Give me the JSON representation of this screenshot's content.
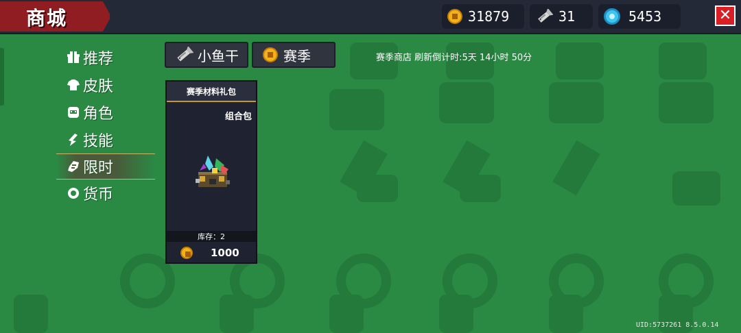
{
  "header": {
    "title": "商城",
    "coins": "31879",
    "fish": "31",
    "gems": "5453",
    "close_label": "✕"
  },
  "nav": {
    "items": [
      {
        "label": "推荐",
        "icon": "gift-icon"
      },
      {
        "label": "皮肤",
        "icon": "shirt-icon"
      },
      {
        "label": "角色",
        "icon": "character-icon"
      },
      {
        "label": "技能",
        "icon": "skill-icon"
      },
      {
        "label": "限时",
        "icon": "limited-time-icon",
        "active": true
      },
      {
        "label": "货币",
        "icon": "currency-icon"
      }
    ]
  },
  "tabs": [
    {
      "label": "小鱼干",
      "icon": "fish-icon"
    },
    {
      "label": "赛季",
      "icon": "coin-icon"
    }
  ],
  "refresh_text": "赛季商店 刷新倒计时:5天 14小时 50分",
  "card": {
    "title": "赛季材料礼包",
    "subtitle": "组合包",
    "stock": "库存：2",
    "price": "1000"
  },
  "footer": {
    "uid": "UID:5737261 8.5.0.14"
  },
  "colors": {
    "background": "#2a8a44",
    "title_flag": "#8f1d22",
    "coin": "#f3b21b",
    "gem": "#3fc6ef",
    "close": "#d81f26"
  }
}
